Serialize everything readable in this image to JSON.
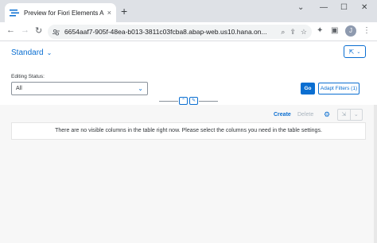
{
  "browser": {
    "tab_title": "Preview for Fiori Elements App",
    "tab_close": "×",
    "new_tab": "+",
    "url": "6654aaf7-905f-48ea-b013-3811c03fcba8.abap-web.us10.hana.on...",
    "avatar_letter": "J",
    "minimize": "—",
    "maximize": "☐",
    "close": "✕",
    "dropdown": "⌄"
  },
  "app": {
    "variant_name": "Standard",
    "filter": {
      "label": "Editing Status:",
      "value": "All"
    },
    "go_label": "Go",
    "adapt_filters_label": "Adapt Filters (1)",
    "table": {
      "create_label": "Create",
      "delete_label": "Delete",
      "empty_message": "There are no visible columns in the table right now. Please select the columns you need in the table settings."
    }
  },
  "colors": {
    "accent": "#0a6ed1",
    "tabstrip": "#dee1e6",
    "content_bg": "#f7f7f7"
  }
}
